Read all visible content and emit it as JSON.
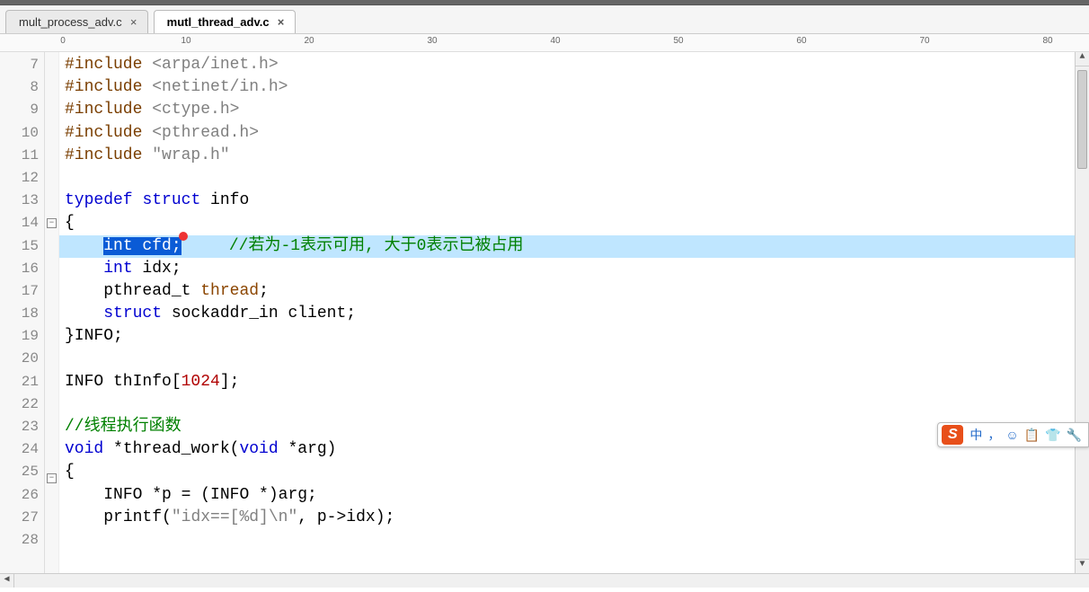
{
  "tabs": [
    {
      "label": "mult_process_adv.c",
      "active": false
    },
    {
      "label": "mutl_thread_adv.c",
      "active": true
    }
  ],
  "ruler_marks": [
    "0",
    "10",
    "20",
    "30",
    "40",
    "50",
    "60",
    "70",
    "80"
  ],
  "line_start": 7,
  "line_end": 28,
  "fold_lines": [
    14,
    25
  ],
  "selected_line": 15,
  "code_lines": {
    "l7": {
      "indent": "",
      "tokens": [
        [
          "pp",
          "#include "
        ],
        [
          "str",
          "<arpa/inet.h>"
        ]
      ]
    },
    "l8": {
      "indent": "",
      "tokens": [
        [
          "pp",
          "#include "
        ],
        [
          "str",
          "<netinet/in.h>"
        ]
      ]
    },
    "l9": {
      "indent": "",
      "tokens": [
        [
          "pp",
          "#include "
        ],
        [
          "str",
          "<ctype.h>"
        ]
      ]
    },
    "l10": {
      "indent": "",
      "tokens": [
        [
          "pp",
          "#include "
        ],
        [
          "str",
          "<pthread.h>"
        ]
      ]
    },
    "l11": {
      "indent": "",
      "tokens": [
        [
          "pp",
          "#include "
        ],
        [
          "str",
          "\"wrap.h\""
        ]
      ]
    },
    "l12": {
      "indent": "",
      "tokens": []
    },
    "l13": {
      "indent": "",
      "tokens": [
        [
          "kw",
          "typedef"
        ],
        [
          "",
          " "
        ],
        [
          "kw",
          "struct"
        ],
        [
          "",
          " info"
        ]
      ]
    },
    "l14": {
      "indent": "",
      "tokens": [
        [
          "",
          "{"
        ]
      ]
    },
    "l15": {
      "indent": "    ",
      "selected_text": "int cfd;",
      "caret": true,
      "tokens": [
        [
          "",
          "    "
        ],
        [
          "cmt",
          "//若为-1表示可用, 大于0表示已被占用"
        ]
      ]
    },
    "l16": {
      "indent": "    ",
      "tokens": [
        [
          "kw",
          "int"
        ],
        [
          "",
          " idx;"
        ]
      ]
    },
    "l17": {
      "indent": "    ",
      "tokens": [
        [
          "",
          "pthread_t "
        ],
        [
          "ident",
          "thread"
        ],
        [
          "",
          ";"
        ]
      ]
    },
    "l18": {
      "indent": "    ",
      "tokens": [
        [
          "kw",
          "struct"
        ],
        [
          "",
          " sockaddr_in client;"
        ]
      ]
    },
    "l19": {
      "indent": "",
      "tokens": [
        [
          "",
          "}INFO;"
        ]
      ]
    },
    "l20": {
      "indent": "",
      "tokens": []
    },
    "l21": {
      "indent": "",
      "tokens": [
        [
          "",
          "INFO thInfo["
        ],
        [
          "num",
          "1024"
        ],
        [
          "",
          "];"
        ]
      ]
    },
    "l22": {
      "indent": "",
      "tokens": []
    },
    "l23": {
      "indent": "",
      "tokens": [
        [
          "cmt",
          "//线程执行函数"
        ]
      ]
    },
    "l24": {
      "indent": "",
      "tokens": [
        [
          "kw",
          "void"
        ],
        [
          "",
          " *thread_work("
        ],
        [
          "kw",
          "void"
        ],
        [
          "",
          " *arg)"
        ]
      ]
    },
    "l25": {
      "indent": "",
      "tokens": [
        [
          "",
          "{"
        ]
      ]
    },
    "l26": {
      "indent": "    ",
      "tokens": [
        [
          "",
          "INFO *p = (INFO *)arg;"
        ]
      ]
    },
    "l27": {
      "indent": "    ",
      "tokens": [
        [
          "",
          "printf("
        ],
        [
          "str",
          "\"idx==[%d]\\n\""
        ],
        [
          "",
          ", p->idx);"
        ]
      ]
    },
    "l28": {
      "indent": "",
      "tokens": []
    }
  },
  "ime": {
    "logo": "S",
    "buttons": [
      "中",
      "，",
      "☺",
      "📋",
      "👕",
      "🔧"
    ]
  }
}
